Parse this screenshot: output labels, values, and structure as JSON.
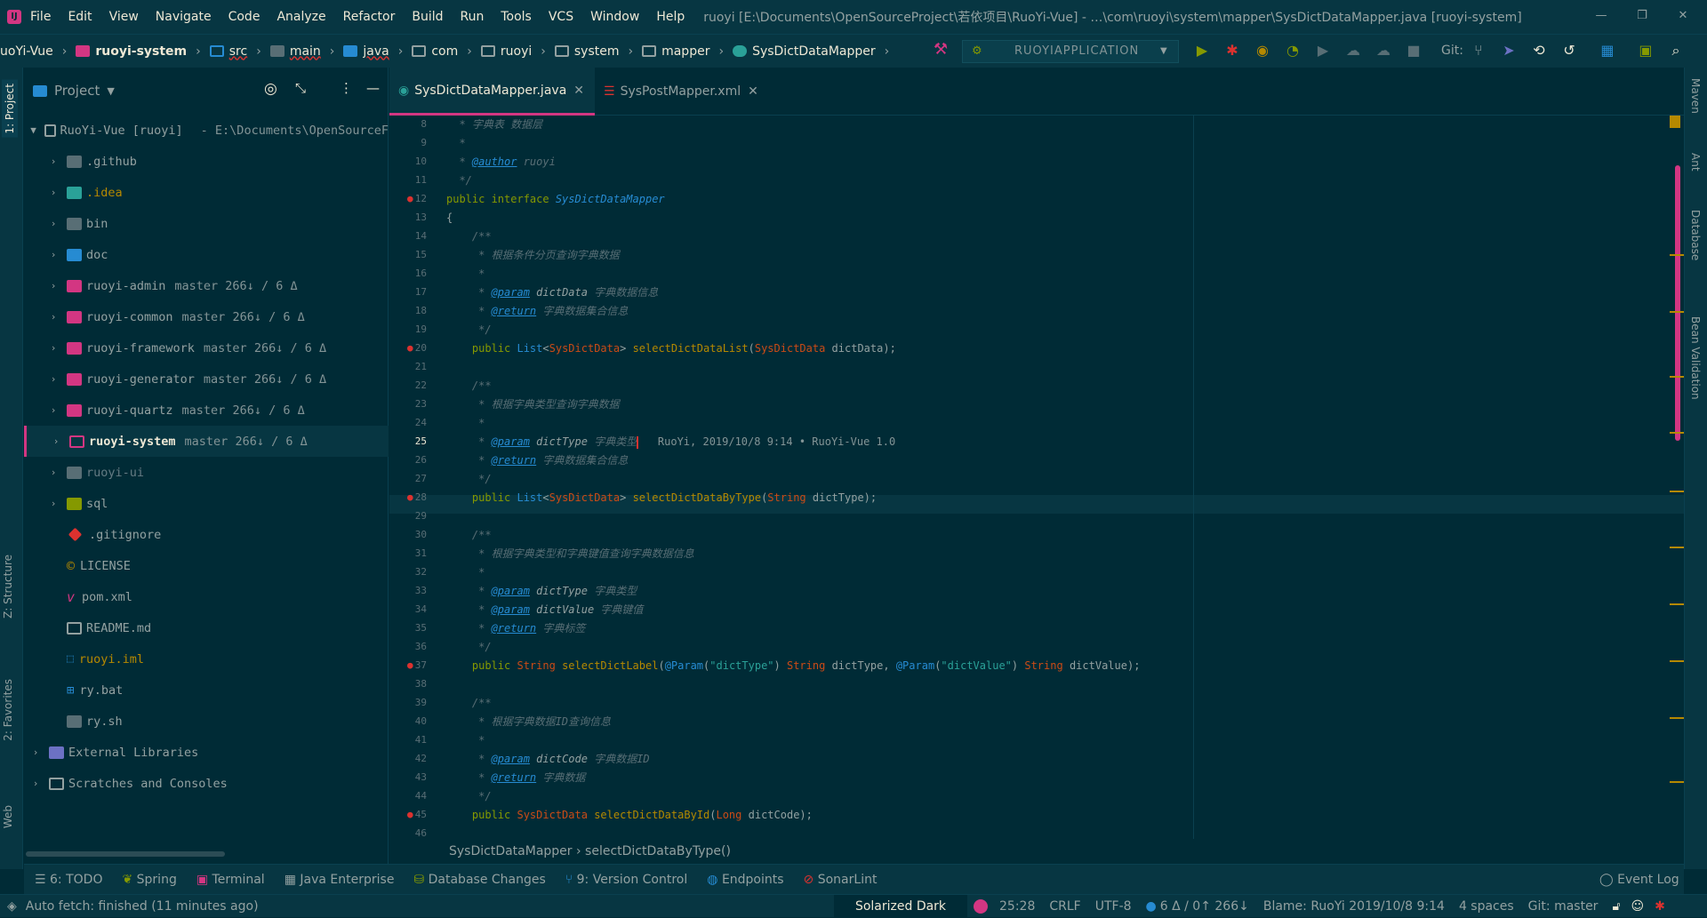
{
  "menu": {
    "items": [
      "File",
      "Edit",
      "View",
      "Navigate",
      "Code",
      "Analyze",
      "Refactor",
      "Build",
      "Run",
      "Tools",
      "VCS",
      "Window",
      "Help"
    ],
    "title": "ruoyi [E:\\Documents\\OpenSourceProject\\若依项目\\RuoYi-Vue] - …\\com\\ruoyi\\system\\mapper\\SysDictDataMapper.java [ruoyi-system]"
  },
  "nav": {
    "crumbs": [
      "uoYi-Vue",
      "ruoyi-system",
      "src",
      "main",
      "java",
      "com",
      "ruoyi",
      "system",
      "mapper",
      "SysDictDataMapper"
    ],
    "run_config": "RUOYIAPPLICATION",
    "git_label": "Git:"
  },
  "left_tabs": {
    "project": "1: Project",
    "structure": "Z: Structure",
    "favorites": "2: Favorites",
    "web": "Web"
  },
  "right_tabs": {
    "maven": "Maven",
    "ant": "Ant",
    "database": "Database",
    "bean": "Bean Validation"
  },
  "project": {
    "header": "Project",
    "root": {
      "name": "RuoYi-Vue [ruoyi]",
      "path": "- E:\\Documents\\OpenSourceF"
    },
    "items": [
      {
        "name": ".github",
        "git": ""
      },
      {
        "name": ".idea",
        "git": ""
      },
      {
        "name": "bin",
        "git": ""
      },
      {
        "name": "doc",
        "git": ""
      },
      {
        "name": "ruoyi-admin",
        "git": "master 266↓ / 6 Δ"
      },
      {
        "name": "ruoyi-common",
        "git": "master 266↓ / 6 Δ"
      },
      {
        "name": "ruoyi-framework",
        "git": "master 266↓ / 6 Δ"
      },
      {
        "name": "ruoyi-generator",
        "git": "master 266↓ / 6 Δ"
      },
      {
        "name": "ruoyi-quartz",
        "git": "master 266↓ / 6 Δ"
      },
      {
        "name": "ruoyi-system",
        "git": "master 266↓ / 6 Δ"
      },
      {
        "name": "ruoyi-ui",
        "git": ""
      },
      {
        "name": "sql",
        "git": ""
      },
      {
        "name": ".gitignore",
        "git": ""
      },
      {
        "name": "LICENSE",
        "git": ""
      },
      {
        "name": "pom.xml",
        "git": ""
      },
      {
        "name": "README.md",
        "git": ""
      },
      {
        "name": "ruoyi.iml",
        "git": ""
      },
      {
        "name": "ry.bat",
        "git": ""
      },
      {
        "name": "ry.sh",
        "git": ""
      }
    ],
    "external": "External Libraries",
    "scratches": "Scratches and Consoles"
  },
  "tabs": [
    {
      "label": "SysDictDataMapper.java"
    },
    {
      "label": "SysPostMapper.xml"
    }
  ],
  "code": {
    "line_numbers": [
      "8",
      "9",
      "10",
      "11",
      "12",
      "13",
      "14",
      "15",
      "16",
      "17",
      "18",
      "19",
      "20",
      "21",
      "22",
      "23",
      "24",
      "25",
      "26",
      "27",
      "28",
      "29",
      "30",
      "31",
      "32",
      "33",
      "34",
      "35",
      "36",
      "37",
      "38",
      "39",
      "40",
      "41",
      "42",
      "43",
      "44",
      "45",
      "46"
    ],
    "blame": "RuoYi, 2019/10/8 9:14 • RuoYi-Vue 1.0",
    "breadcrumb": "SysDictDataMapper › selectDictDataByType()"
  },
  "toolwindows": [
    "6: TODO",
    "Spring",
    "Terminal",
    "Java Enterprise",
    "Database Changes",
    "9: Version Control",
    "Endpoints",
    "SonarLint"
  ],
  "event_log": "Event Log",
  "status": {
    "message": "Auto fetch: finished (11 minutes ago)",
    "theme": "Solarized Dark",
    "position": "25:28",
    "line_sep": "CRLF",
    "encoding": "UTF-8",
    "vcs": "6 Δ / 0↑ 266↓",
    "blame": "Blame: RuoYi 2019/10/8 9:14",
    "indent": "4 spaces",
    "git": "Git: master"
  },
  "colors": {
    "background": "#002b36",
    "panel": "#073642",
    "accent": "#d33682",
    "comment": "#586e75",
    "keyword": "#859900",
    "type": "#cb4b16"
  }
}
